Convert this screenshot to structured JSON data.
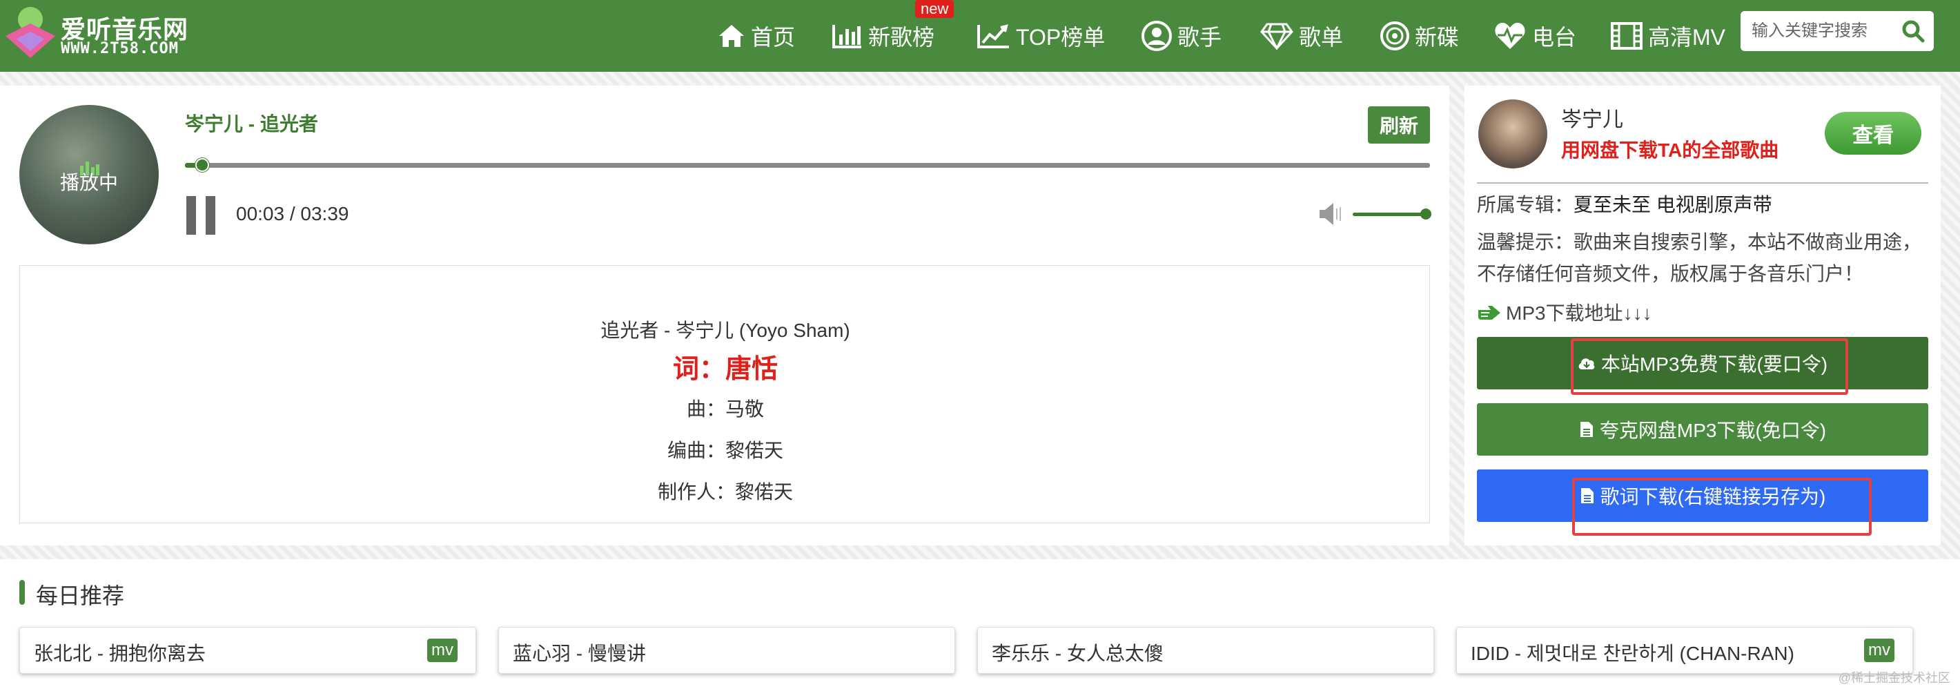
{
  "site": {
    "name": "爱听音乐网",
    "domain": "WWW.2T58.COM"
  },
  "nav": {
    "items": [
      {
        "label": "首页",
        "icon": "home-icon"
      },
      {
        "label": "新歌榜",
        "icon": "bar-chart-icon",
        "badge": "new"
      },
      {
        "label": "TOP榜单",
        "icon": "trend-chart-icon"
      },
      {
        "label": "歌手",
        "icon": "user-circle-icon"
      },
      {
        "label": "歌单",
        "icon": "diamond-icon"
      },
      {
        "label": "新碟",
        "icon": "disc-icon"
      },
      {
        "label": "电台",
        "icon": "heart-pulse-icon"
      },
      {
        "label": "高清MV",
        "icon": "film-icon"
      }
    ],
    "search_placeholder": "输入关键字搜索"
  },
  "player": {
    "cover_status": "播放中",
    "title": "岑宁儿 - 追光者",
    "refresh_label": "刷新",
    "time": "00:03 / 03:39",
    "progress": 0.014,
    "volume": 1.0
  },
  "lyrics": {
    "lines": [
      "追光者 - 岑宁儿 (Yoyo Sham)",
      "词：唐恬",
      "曲：马敬",
      "编曲：黎偌天",
      "制作人：黎偌天"
    ]
  },
  "sidebar": {
    "singer_name": "岑宁儿",
    "singer_download": "用网盘下载TA的全部歌曲",
    "view_label": "查看",
    "album_label": "所属专辑：",
    "album_value": "夏至未至 电视剧原声带",
    "tip": "温馨提示：歌曲来自搜索引擎，本站不做商业用途，不存储任何音频文件，版权属于各音乐门户！",
    "mp3_label": "MP3下载地址↓↓↓",
    "buttons": [
      {
        "label": "本站MP3免费下载(要口令)",
        "color": "#3a6f30"
      },
      {
        "label": "夸克网盘MP3下载(免口令)",
        "color": "#4a8a3f"
      },
      {
        "label": "歌词下载(右键链接另存为)",
        "color": "#2f6af5"
      }
    ]
  },
  "daily": {
    "title": "每日推荐",
    "items": [
      {
        "label": "张北北 - 拥抱你离去",
        "mv": "mv"
      },
      {
        "label": "蓝心羽 - 慢慢讲",
        "mv": ""
      },
      {
        "label": "李乐乐 - 女人总太傻",
        "mv": ""
      },
      {
        "label": "IDID - 제멋대로 찬란하게 (CHAN-RAN)",
        "mv": "mv"
      }
    ]
  },
  "watermark": "@稀土掘金技术社区"
}
